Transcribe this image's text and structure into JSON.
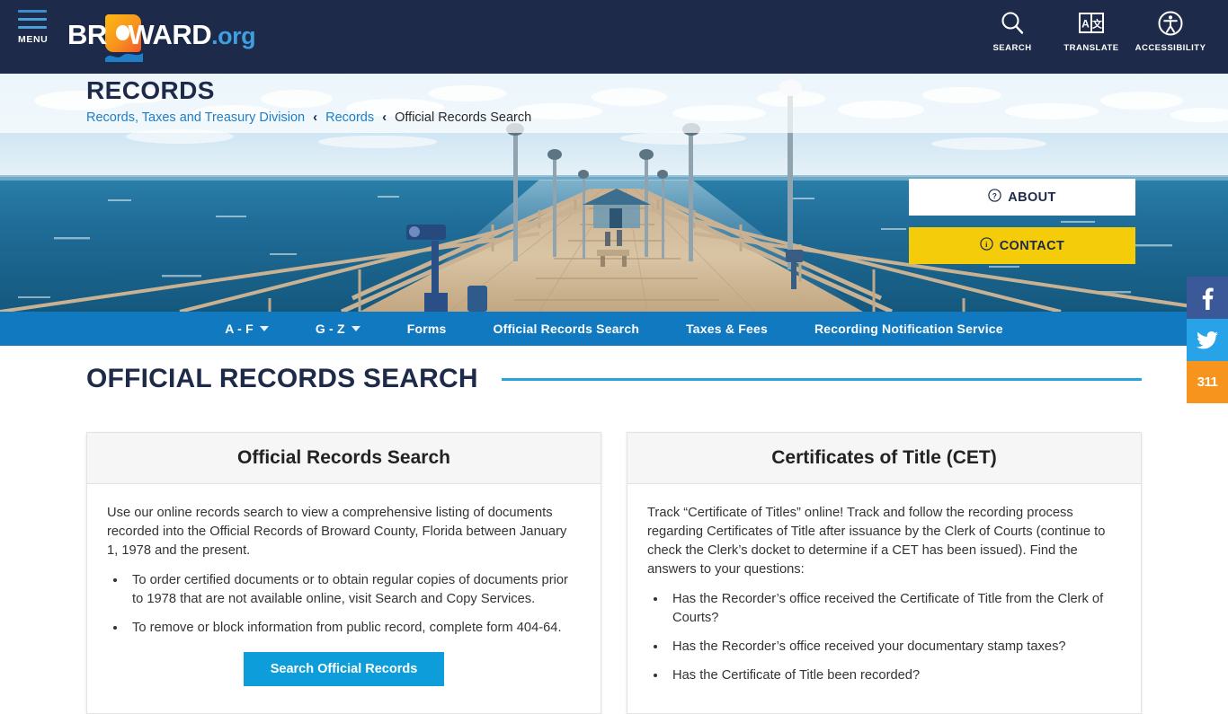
{
  "header": {
    "menu_label": "MENU",
    "logo": {
      "brand": "BR",
      "brand2": "WARD",
      "suffix": ".org",
      "alt": "BROWARD.org"
    },
    "actions": [
      {
        "label": "SEARCH",
        "icon": "search-icon"
      },
      {
        "label": "TRANSLATE",
        "icon": "translate-icon"
      },
      {
        "label": "ACCESSIBILITY",
        "icon": "accessibility-icon"
      }
    ]
  },
  "hero": {
    "title": "RECORDS",
    "breadcrumb": [
      {
        "label": "Records, Taxes and Treasury Division",
        "current": false
      },
      {
        "label": "Records",
        "current": false
      },
      {
        "label": "Official Records Search",
        "current": true
      }
    ],
    "separator": "‹",
    "buttons": [
      {
        "label": "ABOUT",
        "icon": "question-circle-icon",
        "style": "white"
      },
      {
        "label": "CONTACT",
        "icon": "info-circle-icon",
        "style": "yellow"
      }
    ]
  },
  "subnav": {
    "items": [
      {
        "label": "A - F",
        "has_caret": true
      },
      {
        "label": "G - Z",
        "has_caret": true
      },
      {
        "label": "Forms",
        "has_caret": false
      },
      {
        "label": "Official Records Search",
        "has_caret": false
      },
      {
        "label": "Taxes & Fees",
        "has_caret": false
      },
      {
        "label": "Recording Notification Service",
        "has_caret": false
      }
    ]
  },
  "main": {
    "page_title": "OFFICIAL RECORDS SEARCH",
    "cards": [
      {
        "heading": "Official Records Search",
        "paragraph": "Use our online records search to view a comprehensive listing of documents recorded into the Official Records of Broward County, Florida between January 1, 1978 and the present.",
        "bullets": [
          "To order certified documents or to obtain regular copies of documents prior to 1978 that are not available online, visit Search and Copy Services.",
          "To remove or block information from public record, complete form 404-64."
        ],
        "cta": "Search Official Records"
      },
      {
        "heading": "Certificates of Title (CET)",
        "paragraph": "Track “Certificate of Titles” online! Track and follow the recording process regarding Certificates of Title after issuance by the Clerk of Courts (continue to check the Clerk’s docket to determine if a CET has been issued). Find the answers to your questions:",
        "bullets": [
          "Has the Recorder’s office received the Certificate of Title from the Clerk of Courts?",
          "Has the Recorder’s office received your documentary stamp taxes?",
          "Has the Certificate of Title been recorded?"
        ],
        "cta": ""
      }
    ]
  },
  "social": [
    {
      "name": "facebook",
      "glyph": "f",
      "color": "#3b5998"
    },
    {
      "name": "twitter",
      "glyph": "",
      "color": "#29a3e8"
    },
    {
      "name": "311",
      "glyph": "311",
      "color": "#f7941e"
    }
  ],
  "colors": {
    "header_navy": "#1e2a4a",
    "nav_blue": "#1179bf",
    "accent_blue": "#29a3dd",
    "cta_blue": "#0d9ddb",
    "yellow": "#f5cc0a",
    "link_blue": "#1e7ec8"
  }
}
